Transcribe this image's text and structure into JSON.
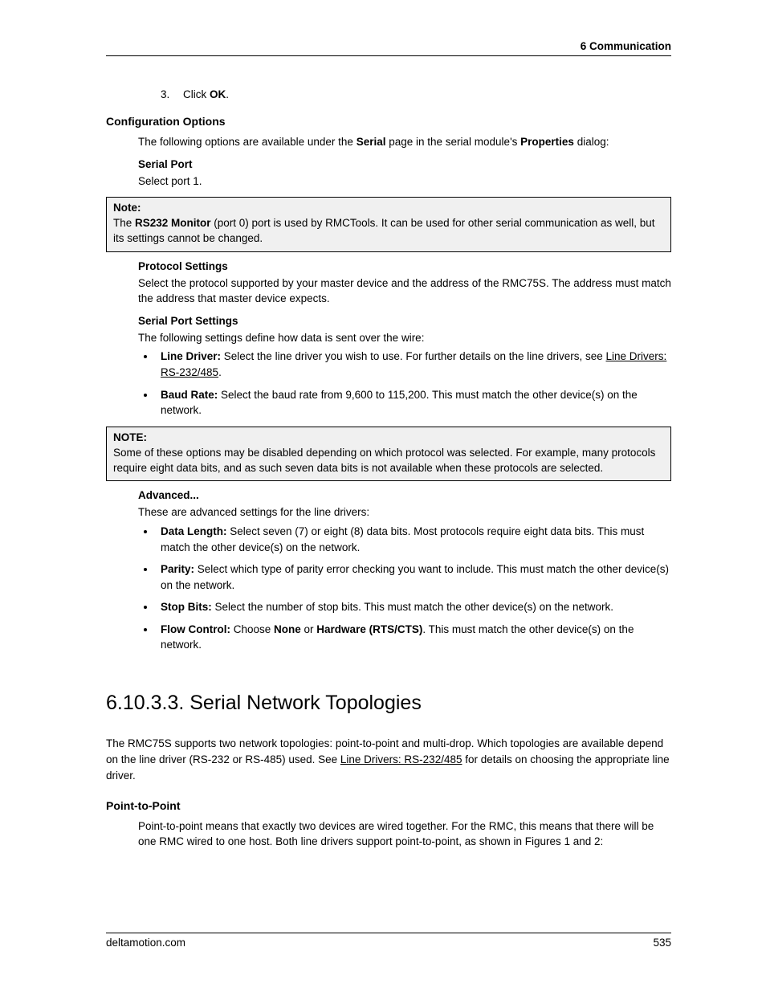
{
  "header": {
    "chapter": "6  Communication"
  },
  "step3": {
    "prefix": "Click ",
    "bold": "OK",
    "suffix": "."
  },
  "configOptions": {
    "heading": "Configuration Options",
    "intro_1": "The following options are available under the ",
    "intro_serial": "Serial",
    "intro_2": " page in the serial module's ",
    "intro_props": "Properties",
    "intro_3": " dialog:"
  },
  "serialPort": {
    "heading": "Serial Port",
    "body": "Select port 1."
  },
  "note1": {
    "label": "Note:",
    "p1_a": "The ",
    "p1_bold": "RS232 Monitor",
    "p1_b": " (port 0) port is used by RMCTools. It can be used for other serial communication as well, but its settings cannot be changed."
  },
  "protocol": {
    "heading": "Protocol Settings",
    "body": "Select the protocol supported by your master device and the address of the RMC75S. The address must match the address that master device expects."
  },
  "sps": {
    "heading": "Serial Port Settings",
    "intro": "The following settings define how data is sent over the wire:",
    "li1_b": "Line Driver:",
    "li1_a": " Select the line driver you wish to use.  For further details on the line drivers, see ",
    "li1_link": "Line Drivers: RS-232/485",
    "li1_c": ".",
    "li2_b": "Baud Rate:",
    "li2_a": " Select the baud rate from 9,600 to 115,200.  This must match the other device(s) on the network."
  },
  "note2": {
    "label": "NOTE:",
    "body": "Some of these options may be disabled depending on which protocol was selected.  For example, many protocols require eight data bits, and as such seven data bits is not available when these protocols are selected."
  },
  "advanced": {
    "heading": "Advanced...",
    "intro": "These are advanced settings for the line drivers:",
    "li1_b": "Data Length:",
    "li1_a": " Select seven (7) or eight (8) data bits.  Most protocols require eight data bits.  This must match the other device(s) on the network.",
    "li2_b": "Parity:",
    "li2_a": " Select which type of parity error checking you want to include.  This must match the other device(s) on the network.",
    "li3_b": "Stop Bits:",
    "li3_a": " Select the number of stop bits.  This must match the other device(s) on the network.",
    "li4_b": "Flow Control:",
    "li4_a": " Choose ",
    "li4_none": "None",
    "li4_or": " or ",
    "li4_hw": "Hardware (RTS/CTS)",
    "li4_c": ". This must match the other device(s) on the network."
  },
  "section": {
    "title": "6.10.3.3. Serial Network Topologies",
    "intro_a": "The RMC75S supports two network topologies: point-to-point and multi-drop. Which topologies are available depend on the line driver (RS-232 or RS-485) used. See ",
    "intro_link": "Line Drivers: RS-232/485",
    "intro_b": " for details on choosing the appropriate line driver."
  },
  "ptp": {
    "heading": "Point-to-Point",
    "body": "Point-to-point means that exactly two devices are wired together. For the RMC, this means that there will be one RMC wired to one host. Both line drivers support point-to-point, as shown in Figures 1 and 2:"
  },
  "footer": {
    "site": "deltamotion.com",
    "page": "535"
  }
}
